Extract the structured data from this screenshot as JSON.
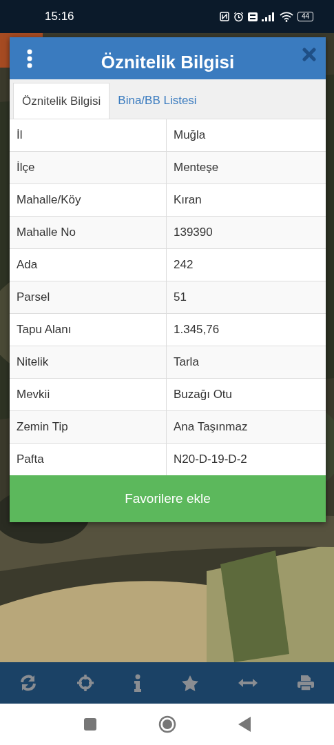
{
  "status_bar": {
    "time": "15:16",
    "battery": "44"
  },
  "dialog": {
    "title": "Öznitelik Bilgisi",
    "tabs": [
      {
        "label": "Öznitelik Bilgisi",
        "selected": true
      },
      {
        "label": "Bina/BB Listesi",
        "selected": false
      }
    ],
    "rows": [
      {
        "label": "İl",
        "value": "Muğla"
      },
      {
        "label": "İlçe",
        "value": "Menteşe"
      },
      {
        "label": "Mahalle/Köy",
        "value": "Kıran"
      },
      {
        "label": "Mahalle No",
        "value": "139390"
      },
      {
        "label": "Ada",
        "value": "242"
      },
      {
        "label": "Parsel",
        "value": "51"
      },
      {
        "label": "Tapu Alanı",
        "value": "1.345,76"
      },
      {
        "label": "Nitelik",
        "value": "Tarla"
      },
      {
        "label": "Mevkii",
        "value": "Buzağı Otu"
      },
      {
        "label": "Zemin Tip",
        "value": "Ana Taşınmaz"
      },
      {
        "label": "Pafta",
        "value": "N20-D-19-D-2"
      }
    ],
    "button": "Favorilere ekle"
  },
  "toolbar": [
    {
      "kind": "refresh"
    },
    {
      "kind": "locate"
    },
    {
      "kind": "info"
    },
    {
      "kind": "star"
    },
    {
      "kind": "measure"
    },
    {
      "kind": "print"
    }
  ]
}
